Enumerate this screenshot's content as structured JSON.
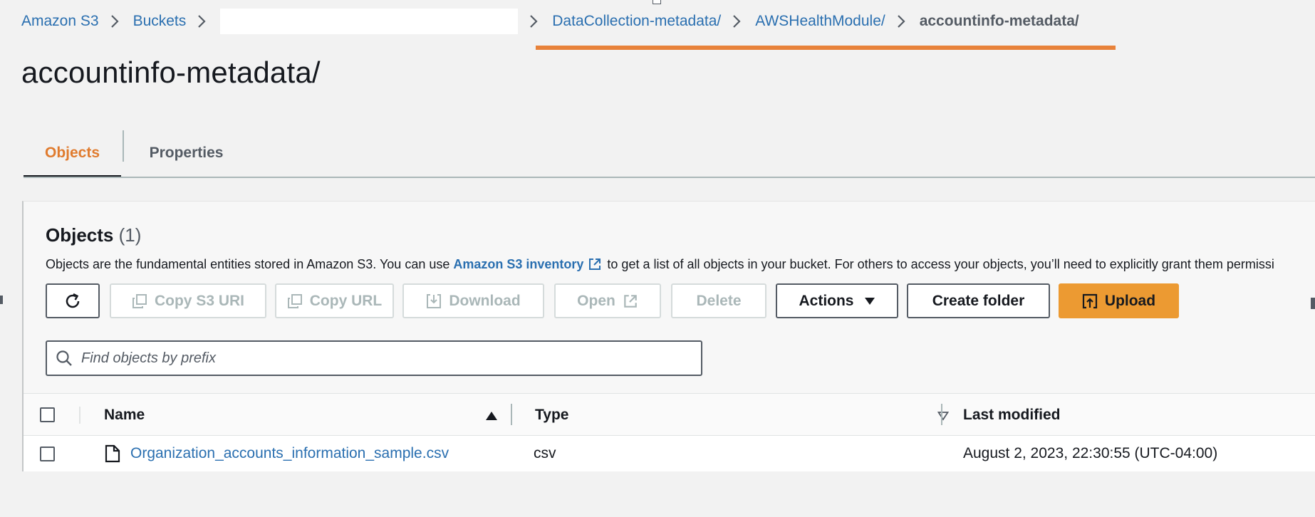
{
  "breadcrumb": {
    "items": [
      {
        "label": "Amazon S3"
      },
      {
        "label": "Buckets"
      },
      {
        "label": ""
      },
      {
        "label": "DataCollection-metadata/"
      },
      {
        "label": "AWSHealthModule/"
      },
      {
        "label": "accountinfo-metadata/"
      }
    ]
  },
  "page": {
    "title": "accountinfo-metadata/"
  },
  "tabs": [
    {
      "label": "Objects"
    },
    {
      "label": "Properties"
    }
  ],
  "objects_panel": {
    "heading": "Objects",
    "count": "(1)",
    "description_before": "Objects are the fundamental entities stored in Amazon S3. You can use ",
    "description_link": "Amazon S3 inventory",
    "description_after": " to get a list of all objects in your bucket. For others to access your objects, you’ll need to explicitly grant them permissi"
  },
  "toolbar": {
    "refresh_icon": "refresh-icon",
    "copy_s3_uri": "Copy S3 URI",
    "copy_url": "Copy URL",
    "download": "Download",
    "open": "Open",
    "delete": "Delete",
    "actions": "Actions",
    "create_folder": "Create folder",
    "upload": "Upload"
  },
  "search": {
    "placeholder": "Find objects by prefix"
  },
  "table": {
    "columns": [
      {
        "label": "Name",
        "sort": "ascending"
      },
      {
        "label": "Type",
        "sort": "none"
      },
      {
        "label": "Last modified"
      }
    ],
    "rows": [
      {
        "name": "Organization_accounts_information_sample.csv",
        "type": "csv",
        "last_modified": "August 2, 2023, 22:30:55 (UTC-04:00)"
      }
    ]
  },
  "colors": {
    "link": "#2a6fb0",
    "active_tab": "#e07b2e",
    "primary_button": "#ec9a32",
    "highlight_underline": "#e8823a"
  }
}
